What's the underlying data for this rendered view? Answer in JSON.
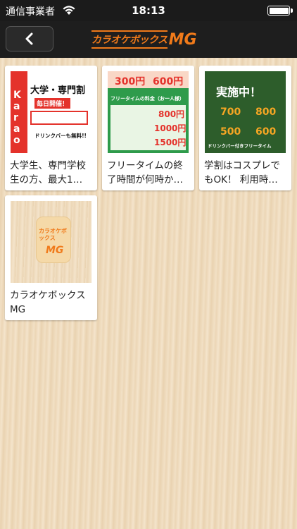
{
  "status_bar": {
    "carrier": "通信事業者",
    "time": "18:13"
  },
  "nav": {
    "back_icon": "chevron-left-icon",
    "logo_kana": "カラオケボックス",
    "logo_mg": "MG"
  },
  "colors": {
    "accent": "#f07a1a",
    "nav_bg": "#1e1e1e"
  },
  "cards": [
    {
      "title": "大学生、専門学校生の方、最大1…",
      "thumb": {
        "headline": "大学・専門割",
        "sub": "毎日開催！",
        "note": "ドリンクバーも無料!!"
      }
    },
    {
      "title": "フリータイムの終了時間が何時か…",
      "thumb": {
        "price_a": "300円",
        "price_b": "600円",
        "heading": "フリータイムの料金（お一人様）",
        "row1": "800円",
        "row2": "1000円",
        "row3": "1500円"
      }
    },
    {
      "title": "学割はコスプレでもOK！ 利用時…",
      "thumb": {
        "headline": "実施中！",
        "price_a": "700",
        "price_b": "800",
        "price_c": "500",
        "price_d": "600",
        "note": "ドリンクバー付きフリータイム"
      }
    },
    {
      "title": "カラオケボックスMG",
      "thumb": {
        "logo_top": "カラオケボックス",
        "logo_bottom": "MG"
      }
    }
  ]
}
